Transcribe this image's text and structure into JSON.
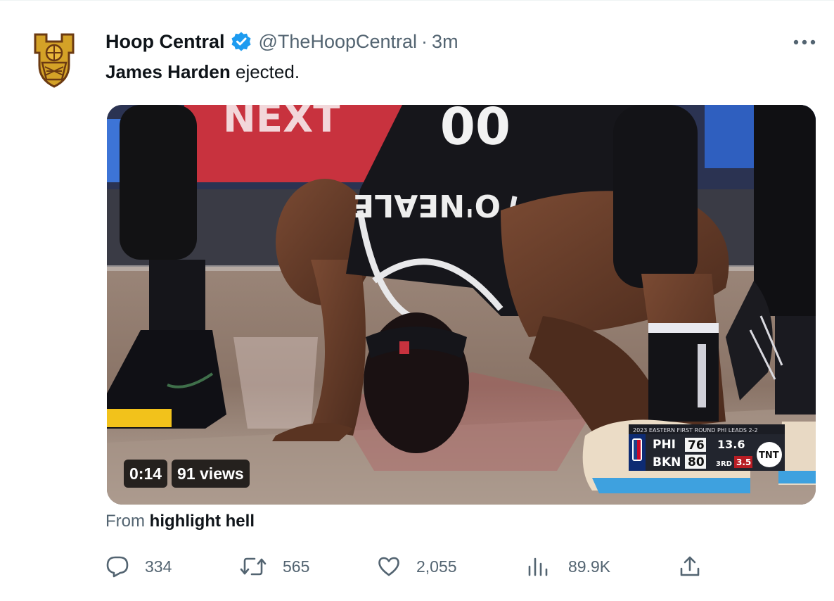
{
  "colors": {
    "verified": "#1d9bf0",
    "text_primary": "#0f1419",
    "text_secondary": "#536471"
  },
  "author": {
    "display_name": "Hoop Central",
    "handle": "@TheHoopCentral",
    "separator": "·",
    "time": "3m",
    "avatar_icon": "hoop-central-logo"
  },
  "tweet": {
    "name_bold": "James Harden",
    "text_rest": " ejected."
  },
  "video": {
    "duration": "0:14",
    "views": "91 views",
    "scene": {
      "jersey_name": "O'NEALE",
      "banner_text": "NEXT"
    },
    "scorebug": {
      "header": "2023 EASTERN FIRST ROUND   PHI LEADS 2-2",
      "team1": "PHI",
      "score1": "76",
      "team2": "BKN",
      "score2": "80",
      "clock": "13.6",
      "quarter": "3RD",
      "shot_clock": "3.5",
      "network": "TNT"
    }
  },
  "source": {
    "prefix": "From ",
    "name": "highlight hell"
  },
  "actions": {
    "reply": {
      "icon": "reply-icon",
      "count": "334"
    },
    "retweet": {
      "icon": "retweet-icon",
      "count": "565"
    },
    "like": {
      "icon": "heart-icon",
      "count": "2,055"
    },
    "views": {
      "icon": "analytics-icon",
      "count": "89.9K"
    },
    "share": {
      "icon": "share-icon"
    }
  }
}
